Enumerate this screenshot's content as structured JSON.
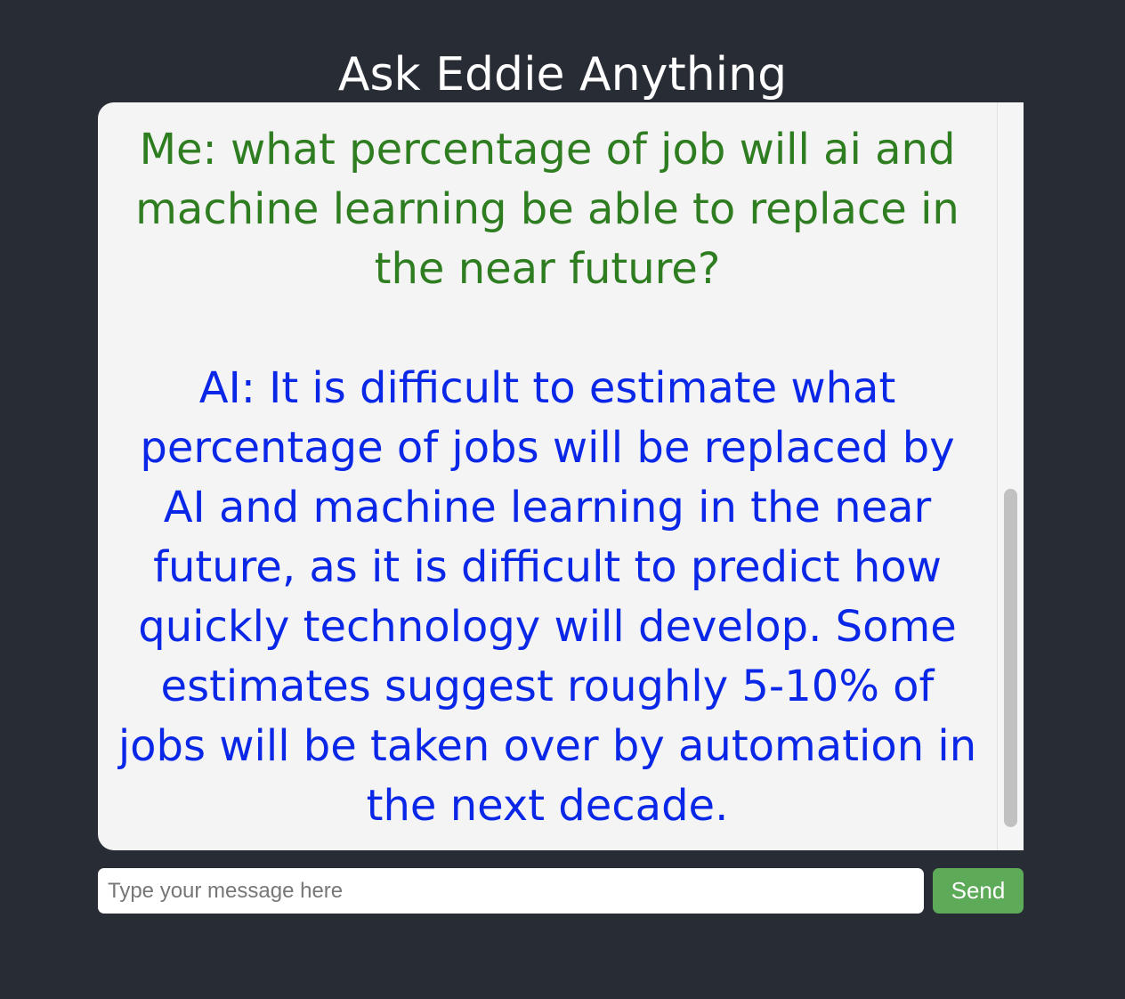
{
  "header": {
    "title": "Ask Eddie Anything"
  },
  "chat": {
    "messages": [
      {
        "speaker": "me",
        "text": "Me: what percentage of job will ai and machine learning be able to replace in the near future?"
      },
      {
        "speaker": "ai",
        "text": "AI: It is difficult to estimate what percentage of jobs will be replaced by AI and machine learning in the near future, as it is difficult to predict how quickly technology will develop. Some estimates suggest roughly 5-10% of jobs will be taken over by automation in the next decade."
      }
    ]
  },
  "composer": {
    "placeholder": "Type your message here",
    "value": "",
    "send_label": "Send"
  },
  "colors": {
    "background": "#282c34",
    "user_message": "#2f7d21",
    "ai_message": "#0a27e8",
    "send_button": "#5daa58"
  }
}
